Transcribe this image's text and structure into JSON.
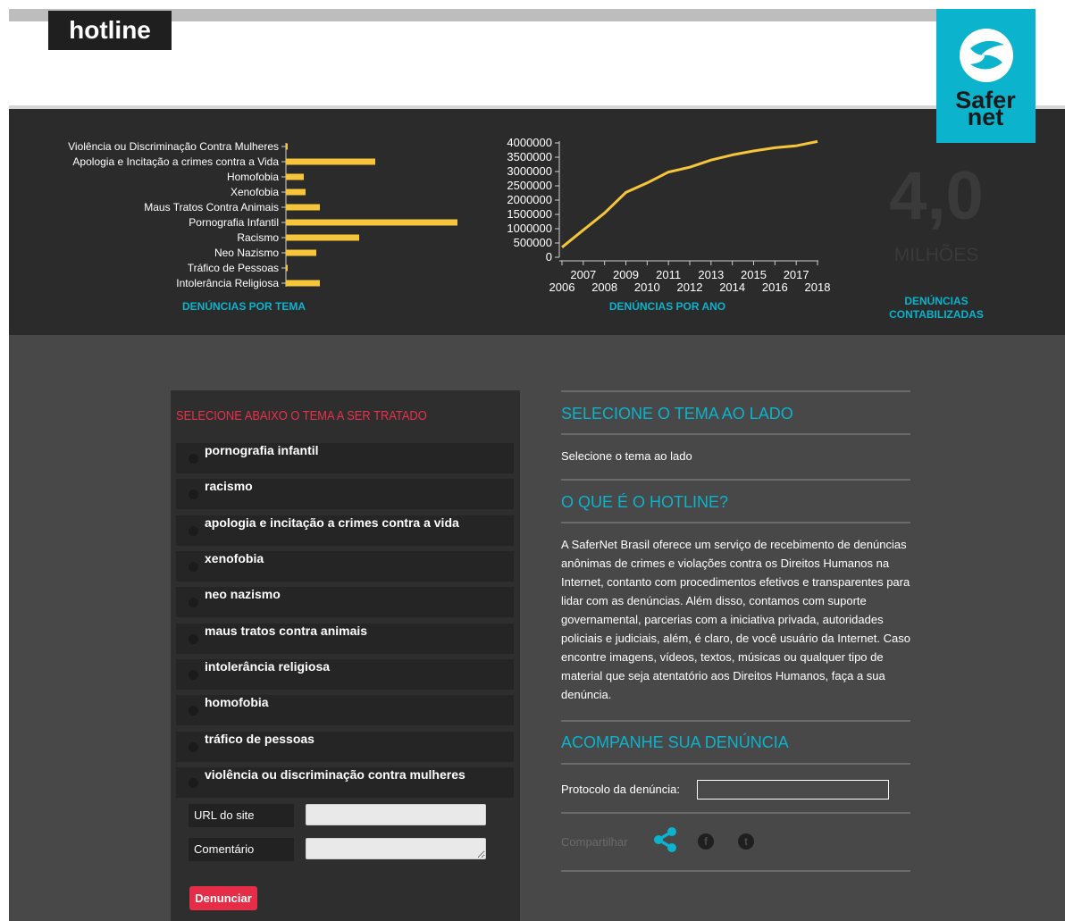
{
  "header": {
    "logo_text": "hotline",
    "brand_logo": {
      "line1": "Safer",
      "line2": "net"
    }
  },
  "stats": {
    "theme_caption": "DENÚNCIAS POR TEMA",
    "year_caption": "DENÚNCIAS POR ANO",
    "total_value": "4,0",
    "total_unit": "MILHÕES",
    "total_caption_line1": "DENÚNCIAS",
    "total_caption_line2": "CONTABILIZADAS"
  },
  "chart_data": [
    {
      "type": "bar",
      "orientation": "horizontal",
      "categories": [
        "Violência ou Discriminação Contra Mulheres",
        "Apologia e Incitação a crimes contra a Vida",
        "Homofobia",
        "Xenofobia",
        "Maus Tratos Contra Animais",
        "Pornografia Infantil",
        "Racismo",
        "Neo Nazismo",
        "Tráfico de Pessoas",
        "Intolerância Religiosa"
      ],
      "values": [
        2,
        100,
        20,
        22,
        38,
        192,
        82,
        34,
        2,
        38
      ],
      "xlabel": "DENÚNCIAS POR TEMA",
      "color": "#f5c63b"
    },
    {
      "type": "line",
      "x": [
        2006,
        2007,
        2008,
        2009,
        2010,
        2011,
        2012,
        2013,
        2014,
        2015,
        2016,
        2017,
        2018
      ],
      "y": [
        350000,
        950000,
        1550000,
        2270000,
        2600000,
        2980000,
        3150000,
        3400000,
        3580000,
        3720000,
        3830000,
        3900000,
        4050000
      ],
      "xticks_upper": [
        "2007",
        "2009",
        "2011",
        "2013",
        "2015",
        "2017"
      ],
      "xticks_lower": [
        "2006",
        "2008",
        "2010",
        "2012",
        "2014",
        "2016",
        "2018"
      ],
      "yticks": [
        "0",
        "500000",
        "1000000",
        "1500000",
        "2000000",
        "2500000",
        "3000000",
        "3500000",
        "4000000"
      ],
      "ylim": [
        0,
        4000000
      ],
      "xlabel": "DENÚNCIAS POR ANO",
      "color": "#f5c63b"
    }
  ],
  "panel": {
    "title": "SELECIONE ABAIXO O TEMA A SER TRATADO",
    "topics": [
      "pornografia infantil",
      "racismo",
      "apologia e incitação a crimes contra a vida",
      "xenofobia",
      "neo nazismo",
      "maus tratos contra animais",
      "intolerância religiosa",
      "homofobia",
      "tráfico de pessoas",
      "violência ou discriminação contra mulheres"
    ],
    "url_label": "URL do site",
    "comment_label": "Comentário",
    "url_value": "",
    "comment_value": "",
    "submit_label": "Denunciar"
  },
  "right": {
    "selected_heading": "SELECIONE O TEMA AO LADO",
    "selected_text": "Selecione o tema ao lado",
    "about_heading": "O QUE É O HOTLINE?",
    "about_text": "A SaferNet Brasil oferece um serviço de recebimento de denúncias anônimas de crimes e violações contra os Direitos Humanos na Internet, contanto com procedimentos efetivos e transparentes para lidar com as denúncias. Além disso, contamos com suporte governamental, parcerias com a iniciativa privada, autoridades policiais e judiciais, além, é claro, de você usuário da Internet. Caso encontre imagens, vídeos, textos, músicas ou qualquer tipo de material que seja atentatório aos Direitos Humanos, faça a sua denúncia.",
    "track_heading": "ACOMPANHE SUA DENÚNCIA",
    "protocol_label": "Protocolo da denúncia:",
    "protocol_value": "",
    "share_label": "Compartilhar",
    "social_icons": [
      "share-icon",
      "facebook-icon",
      "twitter-icon"
    ],
    "social_glyphs": {
      "facebook": "f",
      "twitter": "t"
    }
  },
  "colors": {
    "accent": "#0bb3cd",
    "bar": "#f5c63b",
    "alert": "#e52d47"
  }
}
